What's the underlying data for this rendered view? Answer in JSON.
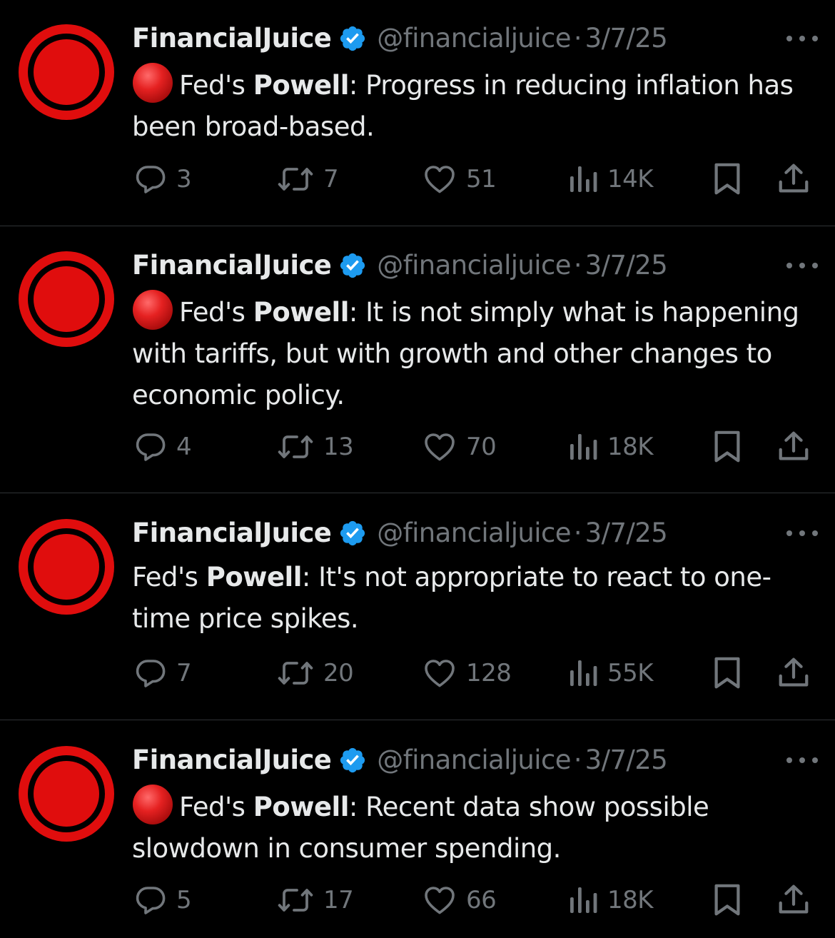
{
  "colors": {
    "background": "#000000",
    "primary_text": "#e7e9ea",
    "secondary_text": "#71767b",
    "verified_blue": "#1d9bf0",
    "avatar_red": "#e00d0d",
    "divider": "#2f3336"
  },
  "icons": {
    "reply": "reply-bubble-icon",
    "repost": "repost-arrows-icon",
    "like": "heart-icon",
    "views": "views-bars-icon",
    "bookmark": "bookmark-icon",
    "share": "share-upload-icon",
    "verified": "verified-badge-icon",
    "more": "more-dots-icon",
    "red_circle": "red-circle-emoji-icon"
  },
  "tweets": [
    {
      "author": {
        "name": "FinancialJuice",
        "handle": "@financialjuice"
      },
      "dot": "·",
      "date": "3/7/25",
      "has_red_circle": true,
      "text": {
        "prefix": "Fed's ",
        "bold": "Powell",
        "rest": ": Progress in reducing inflation has been broad-based."
      },
      "stats": {
        "replies": "3",
        "reposts": "7",
        "likes": "51",
        "views": "14K"
      }
    },
    {
      "author": {
        "name": "FinancialJuice",
        "handle": "@financialjuice"
      },
      "dot": "·",
      "date": "3/7/25",
      "has_red_circle": true,
      "text": {
        "prefix": "Fed's ",
        "bold": "Powell",
        "rest": ": It is not simply what is happening with tariffs, but with growth and other changes to economic policy."
      },
      "stats": {
        "replies": "4",
        "reposts": "13",
        "likes": "70",
        "views": "18K"
      }
    },
    {
      "author": {
        "name": "FinancialJuice",
        "handle": "@financialjuice"
      },
      "dot": "·",
      "date": "3/7/25",
      "has_red_circle": false,
      "text": {
        "prefix": "Fed's ",
        "bold": "Powell",
        "rest": ": It's not appropriate to react to one-time price spikes."
      },
      "stats": {
        "replies": "7",
        "reposts": "20",
        "likes": "128",
        "views": "55K"
      }
    },
    {
      "author": {
        "name": "FinancialJuice",
        "handle": "@financialjuice"
      },
      "dot": "·",
      "date": "3/7/25",
      "has_red_circle": true,
      "text": {
        "prefix": "Fed's ",
        "bold": "Powell",
        "rest": ": Recent data show possible slowdown in consumer spending."
      },
      "stats": {
        "replies": "5",
        "reposts": "17",
        "likes": "66",
        "views": "18K"
      }
    }
  ]
}
